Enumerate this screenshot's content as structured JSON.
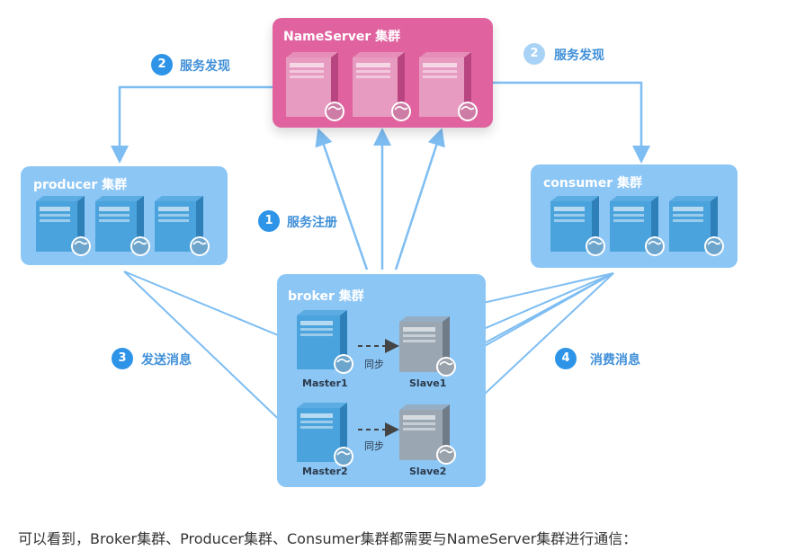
{
  "clusters": {
    "nameserver": {
      "title": "NameServer 集群"
    },
    "producer": {
      "title": "producer 集群"
    },
    "consumer": {
      "title": "consumer 集群"
    },
    "broker": {
      "title": "broker 集群"
    }
  },
  "steps": {
    "register": {
      "num": "1",
      "label": "服务注册"
    },
    "discover_left": {
      "num": "2",
      "label": "服务发现"
    },
    "discover_right": {
      "num": "2",
      "label": "服务发现"
    },
    "send": {
      "num": "3",
      "label": "发送消息"
    },
    "consume": {
      "num": "4",
      "label": "消费消息"
    }
  },
  "broker_nodes": {
    "master1": "Master1",
    "slave1": "Slave1",
    "master2": "Master2",
    "slave2": "Slave2",
    "sync": "同步"
  },
  "caption": "可以看到，Broker集群、Producer集群、Consumer集群都需要与NameServer集群进行通信：",
  "colors": {
    "nameserver_bg": "#e0639f",
    "cluster_bg": "#8cc6f5",
    "arrow": "#7dbdf2",
    "badge_bright": "#2d94e8",
    "badge_light": "#a8d3f6",
    "server_blue": "#4aa3dc",
    "server_pink": "#e89bc0",
    "server_gray": "#9aa6b2"
  }
}
